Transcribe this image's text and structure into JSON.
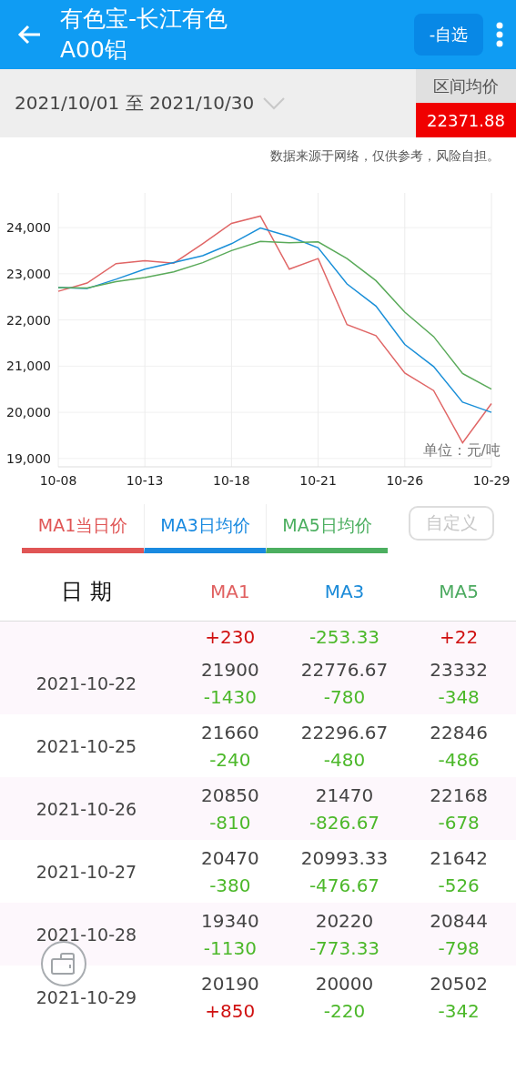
{
  "header": {
    "title_lines": [
      "有色宝-长江有色",
      "A00铝"
    ],
    "watch_button": "-自选"
  },
  "range": {
    "text": "2021/10/01 至 2021/10/30",
    "average_label": "区间均价",
    "average_value": "22371.88"
  },
  "disclaimer": "数据来源于网络，仅供参考，风险自担。",
  "chart": {
    "unit": "单位：元/吨",
    "chart_data": {
      "type": "line",
      "grid": true,
      "categories": [
        "10-08",
        null,
        null,
        "10-13",
        null,
        null,
        "10-18",
        null,
        null,
        "10-21",
        null,
        null,
        "10-26",
        null,
        null,
        "10-29"
      ],
      "ylim": [
        18820,
        24750
      ],
      "yticks": [
        {
          "value": 19000,
          "label": "19,000"
        },
        {
          "value": 20000,
          "label": "20,000"
        },
        {
          "value": 21000,
          "label": "21,000"
        },
        {
          "value": 22000,
          "label": "22,000"
        },
        {
          "value": 23000,
          "label": "23,000"
        },
        {
          "value": 24000,
          "label": "24,000"
        }
      ],
      "series": [
        {
          "color": "#e06666",
          "values": [
            22620,
            22800,
            23220,
            23280,
            23230,
            23650,
            24090,
            24250,
            23100,
            23330,
            21900,
            21660,
            20850,
            20470,
            19340,
            20190
          ]
        },
        {
          "color": "#1a8fd8",
          "values": [
            22700,
            22680,
            22880,
            23100,
            23240,
            23390,
            23650,
            23990,
            23810,
            23560,
            22780,
            22300,
            21470,
            20990,
            20220,
            20000
          ]
        },
        {
          "color": "#5aaa5a",
          "values": [
            22700,
            22690,
            22830,
            22920,
            23040,
            23240,
            23500,
            23700,
            23670,
            23690,
            23330,
            22850,
            22170,
            21640,
            20840,
            20500
          ]
        }
      ]
    }
  },
  "series_tabs": [
    {
      "label": "MA1当日价",
      "color": "#e05555",
      "on": true
    },
    {
      "label": "MA3日均价",
      "color": "#1a8ae0",
      "on": true
    },
    {
      "label": "MA5日均价",
      "color": "#4caf60",
      "on": true
    }
  ],
  "customize_button": {
    "label": "自定义",
    "disabled": true
  },
  "table": {
    "columns": [
      {
        "label": "日 期",
        "color": "#111111"
      },
      {
        "label": "MA1",
        "color": "#e06060"
      },
      {
        "label": "MA3",
        "color": "#1a8ad8"
      },
      {
        "label": "MA5",
        "color": "#4caa60"
      }
    ],
    "rows": [
      {
        "cells": [
          {
            "text": ""
          },
          {
            "change": "+230",
            "kind": "up"
          },
          {
            "change": "-253.33",
            "kind": "down"
          },
          {
            "change": "+22",
            "kind": "up"
          }
        ]
      },
      {
        "cells": [
          {
            "text": "2021-10-22"
          },
          {
            "price": "21900",
            "change": "-1430",
            "kind": "down"
          },
          {
            "price": "22776.67",
            "change": "-780",
            "kind": "down"
          },
          {
            "price": "23332",
            "change": "-348",
            "kind": "down"
          }
        ]
      },
      {
        "cells": [
          {
            "text": "2021-10-25"
          },
          {
            "price": "21660",
            "change": "-240",
            "kind": "down"
          },
          {
            "price": "22296.67",
            "change": "-480",
            "kind": "down"
          },
          {
            "price": "22846",
            "change": "-486",
            "kind": "down"
          }
        ]
      },
      {
        "cells": [
          {
            "text": "2021-10-26"
          },
          {
            "price": "20850",
            "change": "-810",
            "kind": "down"
          },
          {
            "price": "21470",
            "change": "-826.67",
            "kind": "down"
          },
          {
            "price": "22168",
            "change": "-678",
            "kind": "down"
          }
        ]
      },
      {
        "cells": [
          {
            "text": "2021-10-27"
          },
          {
            "price": "20470",
            "change": "-380",
            "kind": "down"
          },
          {
            "price": "20993.33",
            "change": "-476.67",
            "kind": "down"
          },
          {
            "price": "21642",
            "change": "-526",
            "kind": "down"
          }
        ]
      },
      {
        "cells": [
          {
            "text": "2021-10-28"
          },
          {
            "price": "19340",
            "change": "-1130",
            "kind": "down"
          },
          {
            "price": "20220",
            "change": "-773.33",
            "kind": "down"
          },
          {
            "price": "20844",
            "change": "-798",
            "kind": "down"
          }
        ]
      },
      {
        "cells": [
          {
            "text": "2021-10-29"
          },
          {
            "price": "20190",
            "change": "+850",
            "kind": "up"
          },
          {
            "price": "20000",
            "change": "-220",
            "kind": "down"
          },
          {
            "price": "20502",
            "change": "-342",
            "kind": "down"
          }
        ]
      }
    ]
  }
}
